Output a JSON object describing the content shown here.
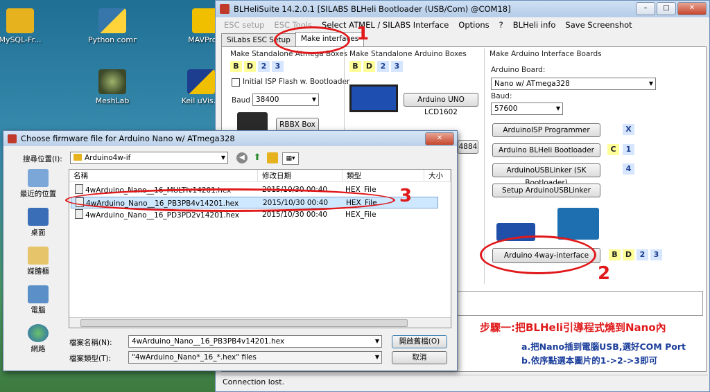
{
  "desktop": {
    "icons": [
      {
        "label": "MySQL-Fr..."
      },
      {
        "label": "Python comma..."
      },
      {
        "label": "MAVPro..."
      },
      {
        "label": "MeshLab"
      },
      {
        "label": "Keil uVis..."
      }
    ]
  },
  "blheli": {
    "title": "BLHeliSuite 14.2.0.1  [SILABS BLHeli Bootloader (USB/Com) @COM18]",
    "menu": [
      "ESC setup",
      "ESC Tools",
      "Select ATMEL / SILABS Interface",
      "Options",
      "?",
      "BLHeli info",
      "Save Screenshot"
    ],
    "tabs": [
      "SiLabs ESC Setup",
      "Make interfaces"
    ],
    "atmega": {
      "title": "Make Standalone Atmega Boxes",
      "chips": [
        "B",
        "D",
        "2",
        "3"
      ],
      "isp_label": "Initial ISP Flash w. Bootloader",
      "baud_label": "Baud",
      "baud_value": "38400",
      "rbbx_btn": "RBBX Box"
    },
    "arduino_box": {
      "title": "Make Standalone Arduino Boxes",
      "chips": [
        "B",
        "D",
        "2",
        "3"
      ],
      "lcd_btn": "Arduino UNO LCD1602",
      "partial_btn": "4884"
    },
    "interface": {
      "title": "Make Arduino Interface Boards",
      "board_label": "Arduino Board:",
      "board_value": "Nano w/ ATmega328",
      "baud_label": "Baud:",
      "baud_value": "57600",
      "buttons": [
        {
          "label": "ArduinoISP Programmer",
          "chips": [
            "X"
          ]
        },
        {
          "label": "Arduino BLHeli Bootloader",
          "chips": [
            "C",
            "1"
          ]
        },
        {
          "label": "ArduinoUSBLinker (SK Bootloader)",
          "chips": [
            "4"
          ]
        },
        {
          "label": "Setup ArduinoUSBLinker",
          "chips": []
        }
      ],
      "fourway_btn": "Arduino 4way-interface",
      "fourway_chips": [
        "B",
        "D",
        "2",
        "3"
      ]
    },
    "status": "Connection lost."
  },
  "dialog": {
    "title": "Choose firmware file for Arduino Nano w/ ATmega328",
    "lookin_label": "搜尋位置(I):",
    "lookin_value": "Arduino4w-if",
    "places": [
      "最近的位置",
      "桌面",
      "媒體櫃",
      "電腦",
      "網路"
    ],
    "columns": [
      "名稱",
      "修改日期",
      "類型",
      "大小"
    ],
    "files": [
      {
        "name": "4wArduino_Nano__16_MULTIv14201.hex",
        "date": "2015/10/30 00:40",
        "type": "HEX_File"
      },
      {
        "name": "4wArduino_Nano__16_PB3PB4v14201.hex",
        "date": "2015/10/30 00:40",
        "type": "HEX_File"
      },
      {
        "name": "4wArduino_Nano__16_PD3PD2v14201.hex",
        "date": "2015/10/30 00:40",
        "type": "HEX_File"
      }
    ],
    "filename_label": "檔案名稱(N):",
    "filename_value": "4wArduino_Nano__16_PB3PB4v14201.hex",
    "filetype_label": "檔案類型(T):",
    "filetype_value": "\"4wArduino_Nano*_16_*.hex\" files",
    "open_btn": "開啟舊檔(O)",
    "cancel_btn": "取消"
  },
  "annotations": {
    "step1": "1",
    "step2": "2",
    "step3": "3",
    "heading": "步驟一:把BLHeli引導程式燒到Nano內",
    "line_a": "a.把Nano插到電腦USB,選好COM Port",
    "line_b": "b.依序點選本圖片的1->2->3即可"
  },
  "colors": {
    "annotation_red": "#e0191b",
    "annotation_blue": "#1a3d9a",
    "selected_row": "#cde8ff"
  }
}
